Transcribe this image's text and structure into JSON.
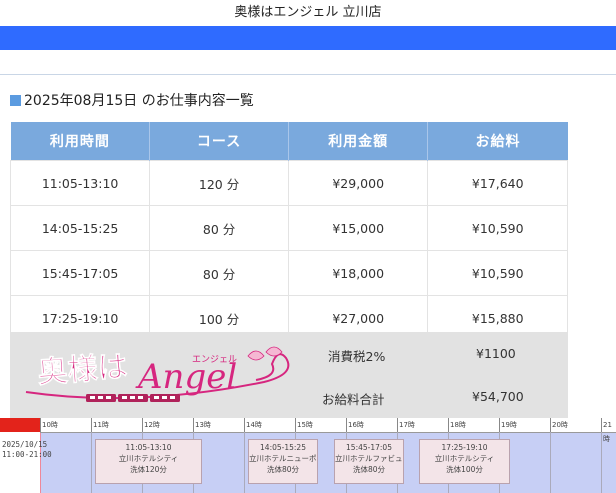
{
  "header": {
    "shop_name": "奥様はエンジェル 立川店"
  },
  "page": {
    "heading": "2025年08月15日 のお仕事内容一覧"
  },
  "table": {
    "columns": [
      "利用時間",
      "コース",
      "利用金額",
      "お給料"
    ],
    "rows": [
      [
        "11:05-13:10",
        "120 分",
        "¥29,000",
        "¥17,640"
      ],
      [
        "14:05-15:25",
        "80 分",
        "¥15,000",
        "¥10,590"
      ],
      [
        "15:45-17:05",
        "80 分",
        "¥18,000",
        "¥10,590"
      ],
      [
        "17:25-19:10",
        "100 分",
        "¥27,000",
        "¥15,880"
      ]
    ]
  },
  "summary": {
    "tax_label": "消費税2%",
    "tax_value": "¥1100",
    "total_label": "お給料合計",
    "total_value": "¥54,700"
  },
  "logo": {
    "text_main": "奥様は",
    "text_script": "Angel",
    "text_small": "エンジェル"
  },
  "timeline": {
    "date": "2025/10/15",
    "shift": "11:00-21:00",
    "hours": [
      "10時",
      "11時",
      "12時",
      "13時",
      "14時",
      "15時",
      "16時",
      "17時",
      "18時",
      "19時",
      "20時",
      "21時"
    ],
    "blocks": [
      {
        "time": "11:05-13:10",
        "place": "立川ホテルシティ",
        "course": "洗体120分"
      },
      {
        "time": "14:05-15:25",
        "place": "立川ホテルニューポー",
        "course": "洗体80分"
      },
      {
        "time": "15:45-17:05",
        "place": "立川ホテルファビュラ",
        "course": "洗体80分"
      },
      {
        "time": "17:25-19:10",
        "place": "立川ホテルシティ",
        "course": "洗体100分"
      }
    ]
  },
  "colors": {
    "blue_bar": "#2f6bff",
    "table_header": "#7aa9dd",
    "timeline_bg": "#c7cff5",
    "logo_pink": "#d6267f"
  }
}
